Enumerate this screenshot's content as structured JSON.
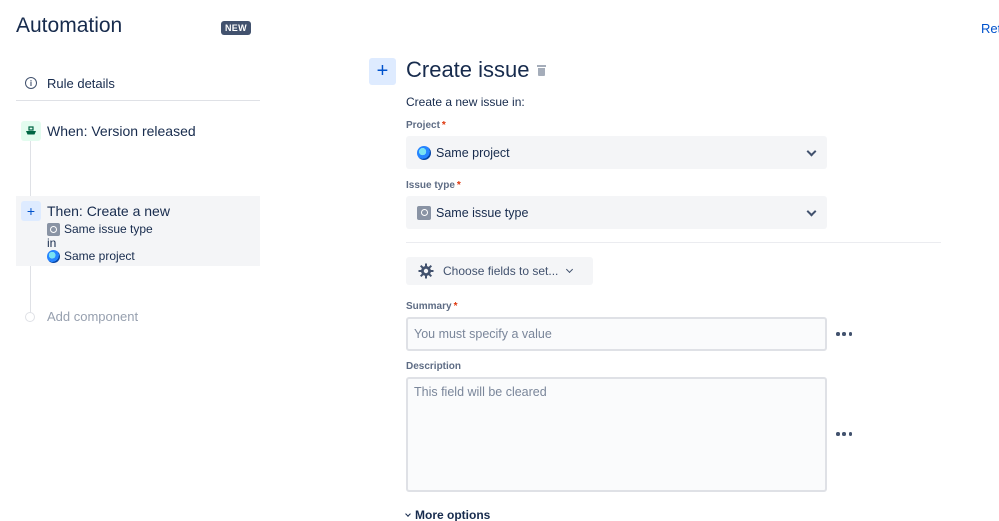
{
  "app": {
    "title": "Automation",
    "badge": "NEW",
    "top_link": "Ret"
  },
  "sidebar": {
    "rule_details": "Rule details",
    "trigger": {
      "label": "When: Version released"
    },
    "action": {
      "title": "Then: Create a new",
      "issue_type": "Same issue type",
      "connector": "in",
      "project": "Same project"
    },
    "add_component": "Add component"
  },
  "panel": {
    "title": "Create issue",
    "subtitle": "Create a new issue in:",
    "project": {
      "label": "Project",
      "required": "*",
      "value": "Same project"
    },
    "issue_type": {
      "label": "Issue type",
      "required": "*",
      "value": "Same issue type"
    },
    "choose_fields": "Choose fields to set...",
    "summary": {
      "label": "Summary",
      "required": "*",
      "placeholder": "You must specify a value"
    },
    "description": {
      "label": "Description",
      "placeholder": "This field will be cleared"
    },
    "more_options": "More options"
  },
  "colors": {
    "accent": "#0052cc",
    "accent_bg": "#deebff",
    "text": "#172b4d",
    "required": "#de350b",
    "trigger_bg": "#e3fcef"
  }
}
